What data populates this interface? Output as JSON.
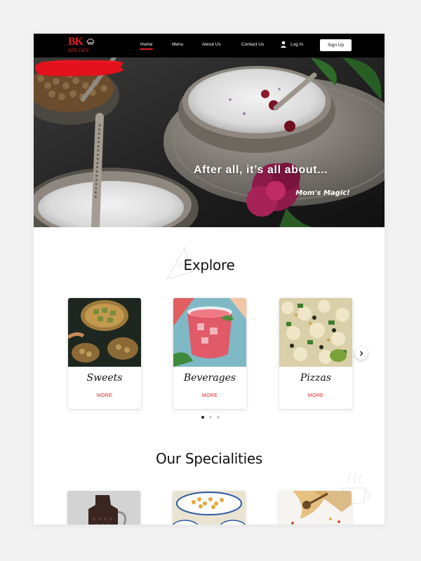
{
  "nav": {
    "logo_text": "BK",
    "logo_subtext": "KITCHEN",
    "links": [
      {
        "label": "Home",
        "active": true
      },
      {
        "label": "Menu",
        "active": false
      },
      {
        "label": "About Us",
        "active": false
      },
      {
        "label": "Contact Us",
        "active": false
      }
    ],
    "login_label": "Log In",
    "login_icon": "user-icon",
    "signup_label": "Sign Up"
  },
  "hero": {
    "title": "After all, it’s all about...",
    "tagline": "Mom's Magic!"
  },
  "explore": {
    "title": "Explore",
    "cards": [
      {
        "name": "Sweets",
        "more": "MORE"
      },
      {
        "name": "Beverages",
        "more": "MORE"
      },
      {
        "name": "Pizzas",
        "more": "MORE"
      }
    ],
    "next_icon": "chevron-right-icon",
    "pagination": {
      "pages": 3,
      "current": 1
    }
  },
  "specialities": {
    "title": "Our Specialities"
  },
  "colors": {
    "accent": "#d81f26",
    "nav_bg": "#000000",
    "page_bg": "#ffffff"
  }
}
